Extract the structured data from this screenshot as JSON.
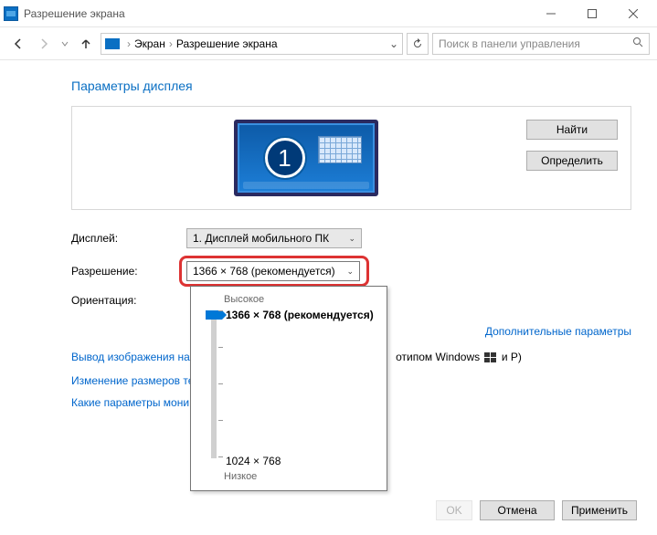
{
  "titlebar": {
    "title": "Разрешение экрана"
  },
  "breadcrumb": {
    "part1": "Экран",
    "part2": "Разрешение экрана",
    "search_placeholder": "Поиск в панели управления"
  },
  "page": {
    "heading": "Параметры дисплея",
    "find_btn": "Найти",
    "detect_btn": "Определить",
    "monitor_num": "1"
  },
  "form": {
    "display_label": "Дисплей:",
    "display_value": "1. Дисплей мобильного ПК",
    "resolution_label": "Разрешение:",
    "resolution_value": "1366 × 768 (рекомендуется)",
    "orientation_label": "Ориентация:"
  },
  "popup": {
    "high": "Высокое",
    "low": "Низкое",
    "opt_recommended": "1366 × 768 (рекомендуется)",
    "opt_low": "1024 × 768"
  },
  "links": {
    "advanced": "Дополнительные параметры",
    "project_prefix": "Вывод изображения на",
    "project_suffix_a": "отипом Windows",
    "project_suffix_b": " и P)",
    "text_size": "Изменение размеров те",
    "which_settings": "Какие параметры мони"
  },
  "buttons": {
    "ok": "OK",
    "cancel": "Отмена",
    "apply": "Применить"
  }
}
